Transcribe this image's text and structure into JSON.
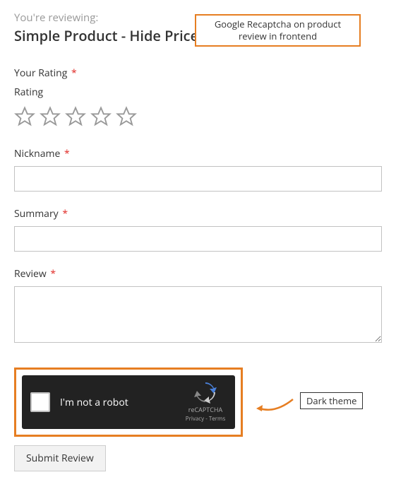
{
  "intro": "You're reviewing:",
  "product_name": "Simple Product - Hide Price",
  "annotation_top": "Google Recaptcha on product review in frontend",
  "annotation_dark": "Dark theme",
  "rating": {
    "label": "Your Rating",
    "sublabel": "Rating"
  },
  "nickname": {
    "label": "Nickname"
  },
  "summary": {
    "label": "Summary"
  },
  "review": {
    "label": "Review"
  },
  "recaptcha": {
    "text": "I'm not a robot",
    "brand": "reCAPTCHA",
    "links": "Privacy - Terms"
  },
  "submit_label": "Submit Review"
}
